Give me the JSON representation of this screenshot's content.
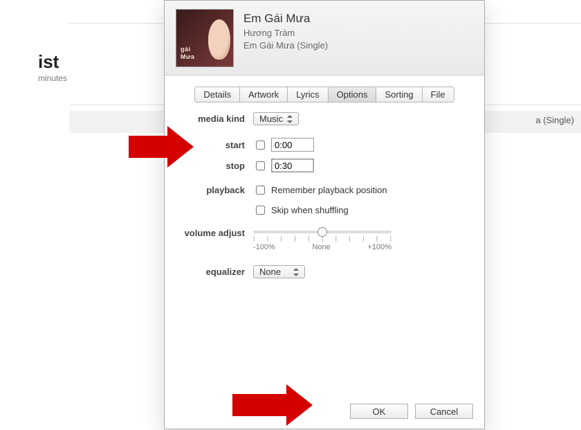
{
  "background": {
    "title_fragment": "ist",
    "subtitle_fragment": "minutes",
    "row_text_fragment": "a (Single)"
  },
  "header": {
    "song_title": "Em Gái Mưa",
    "artist": "Hương Tràm",
    "album": "Em Gái Mưa (Single)",
    "art_text_line1": "gái",
    "art_text_line2": "Mưa"
  },
  "tabs": [
    "Details",
    "Artwork",
    "Lyrics",
    "Options",
    "Sorting",
    "File"
  ],
  "active_tab_index": 3,
  "form": {
    "media_kind": {
      "label": "media kind",
      "value": "Music"
    },
    "start": {
      "label": "start",
      "value": "0:00",
      "checked": false
    },
    "stop": {
      "label": "stop",
      "value": "0:30",
      "checked": false
    },
    "playback": {
      "label": "playback",
      "remember": {
        "label": "Remember playback position",
        "checked": false
      },
      "skip": {
        "label": "Skip when shuffling",
        "checked": false
      }
    },
    "volume": {
      "label": "volume adjust",
      "min_label": "-100%",
      "mid_label": "None",
      "max_label": "+100%"
    },
    "equalizer": {
      "label": "equalizer",
      "value": "None"
    }
  },
  "buttons": {
    "ok": "OK",
    "cancel": "Cancel"
  }
}
